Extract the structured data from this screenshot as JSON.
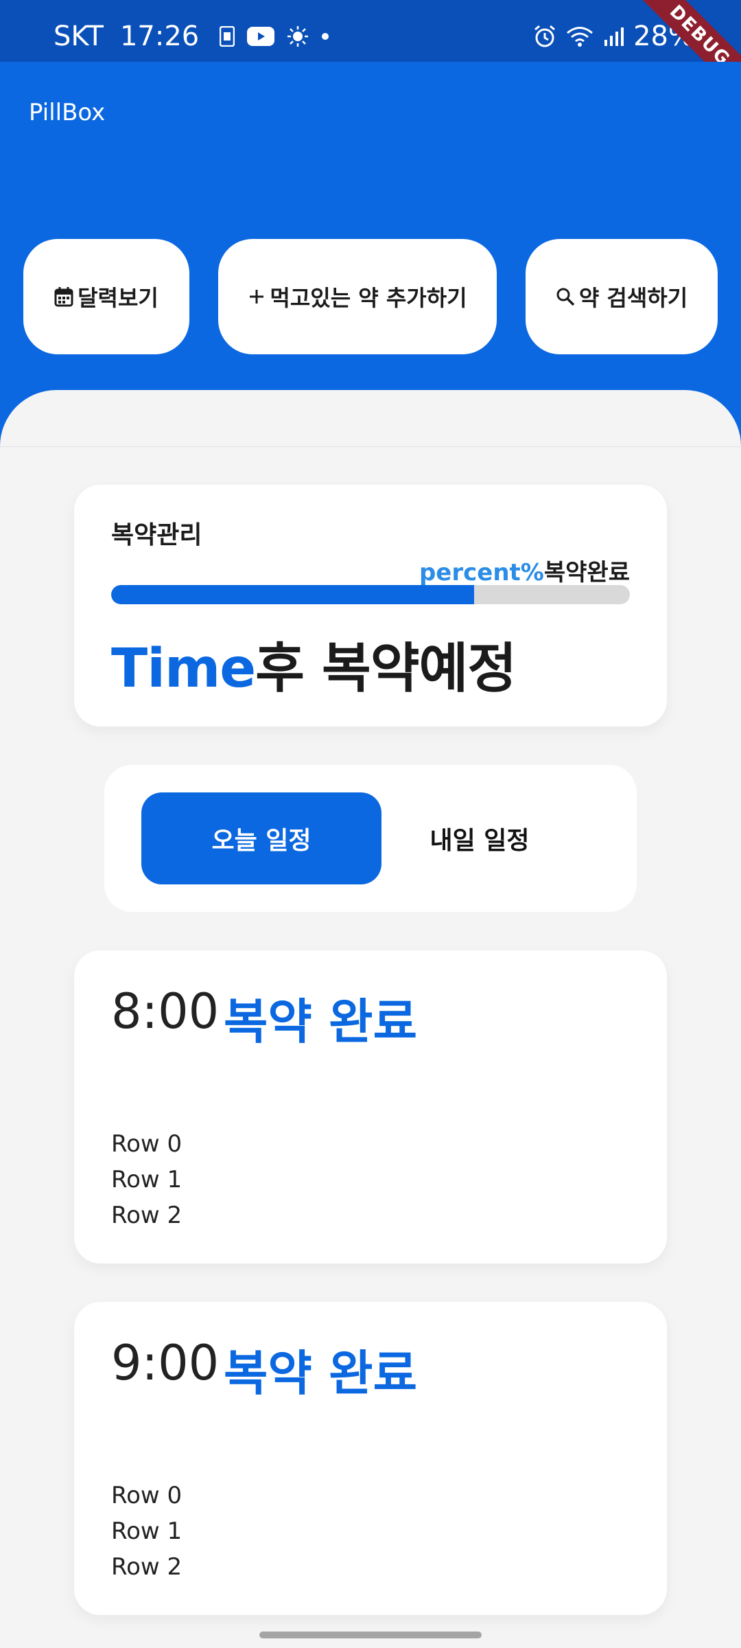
{
  "status_bar": {
    "carrier": "SKT",
    "time": "17:26",
    "battery": "28%",
    "icons_left": [
      "sim-card-icon",
      "youtube-icon",
      "brightness-icon",
      "dot-icon"
    ],
    "icons_right": [
      "alarm-icon",
      "wifi-icon",
      "signal-icon",
      "battery-icon"
    ]
  },
  "debug_banner": "DEBUG",
  "app": {
    "title": "PillBox"
  },
  "quick_actions": [
    {
      "icon": "calendar-icon",
      "label": "달력보기"
    },
    {
      "icon": "plus-icon",
      "label": "먹고있는 약 추가하기"
    },
    {
      "icon": "search-icon",
      "label": "약 검색하기"
    }
  ],
  "management": {
    "title": "복약관리",
    "percent_text": "percent%",
    "percent_suffix": "복약완료",
    "progress": 0.7,
    "next_time": "Time",
    "next_suffix": "후 복약예정"
  },
  "tabs": [
    {
      "label": "오늘 일정",
      "active": true
    },
    {
      "label": "내일 일정",
      "active": false
    }
  ],
  "schedules": [
    {
      "time": "8:00",
      "status": "복약 완료",
      "rows": [
        "Row 0",
        "Row 1",
        "Row 2"
      ]
    },
    {
      "time": "9:00",
      "status": "복약 완료",
      "rows": [
        "Row 0",
        "Row 1",
        "Row 2"
      ]
    }
  ],
  "colors": {
    "primary": "#0b68e0",
    "status_bar": "#0a50b8",
    "percent_accent": "#2b8de6",
    "background": "#f4f4f4",
    "debug": "#8e1f2e"
  }
}
